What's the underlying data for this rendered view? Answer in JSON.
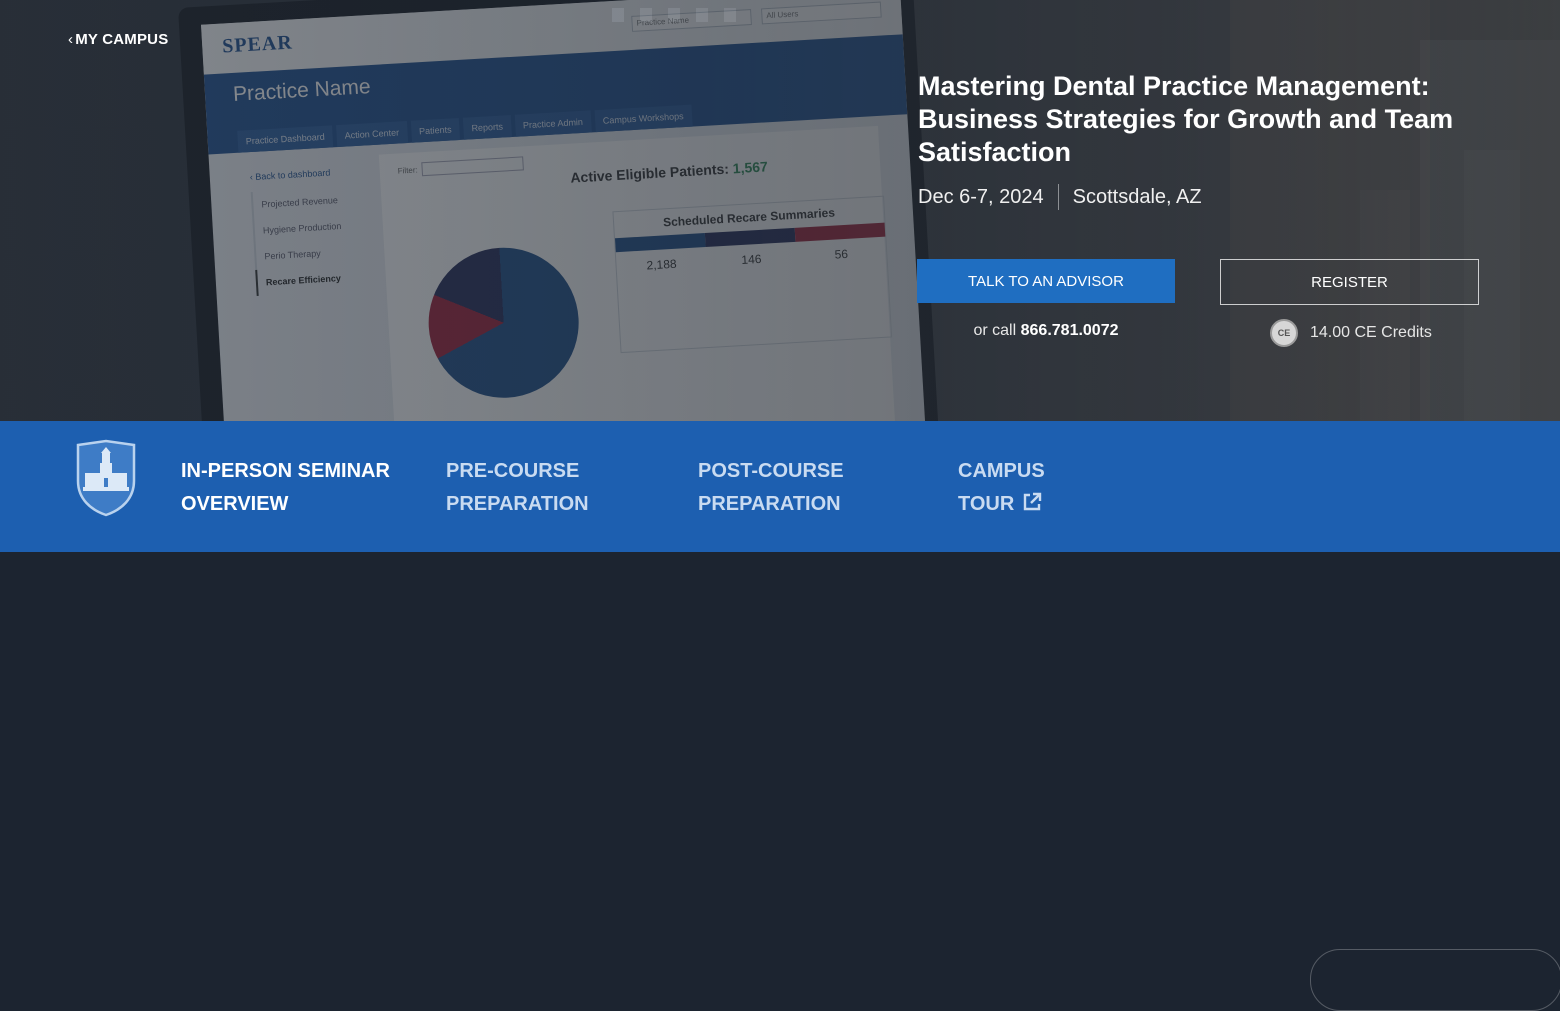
{
  "hero": {
    "back_link": "MY CAMPUS",
    "title": "Mastering Dental Practice Management: Business Strategies for Growth and Team Satisfaction",
    "date": "Dec 6-7, 2024",
    "location": "Scottsdale, AZ",
    "advisor_button": "TALK TO AN ADVISOR",
    "register_button": "REGISTER",
    "call_prefix": "or call",
    "phone": "866.781.0072",
    "ce_badge": "CE",
    "ce_credits": "14.00 CE Credits"
  },
  "mockup": {
    "logo": "SPEAR",
    "select_practice": "Practice Name",
    "select_users": "All Users",
    "practice_name": "Practice Name",
    "tabs": [
      "Practice Dashboard",
      "Action Center",
      "Patients",
      "Reports",
      "Practice Admin",
      "Campus Workshops"
    ],
    "back": "‹ Back to dashboard",
    "side_items": [
      "Projected Revenue",
      "Hygiene Production",
      "Perio Therapy",
      "Recare Efficiency"
    ],
    "filter_label": "Filter:",
    "active_label": "Active Eligible Patients:",
    "active_value": "1,567",
    "sched_title": "Scheduled Recare Summaries",
    "sched_values": [
      "2,188",
      "146",
      "56"
    ]
  },
  "colors": {
    "primary_blue": "#1d5fb0",
    "button_blue": "#1f6ec1",
    "hero_dark": "#2b323b"
  },
  "nav": {
    "items": [
      {
        "line1": "IN-PERSON SEMINAR",
        "line2": "OVERVIEW"
      },
      {
        "line1": "PRE-COURSE",
        "line2": "PREPARATION"
      },
      {
        "line1": "POST-COURSE",
        "line2": "PREPARATION"
      },
      {
        "line1": "CAMPUS",
        "line2": "TOUR"
      }
    ],
    "logo_icon": "campus-shield-icon",
    "external_icon": "external-link-icon"
  }
}
